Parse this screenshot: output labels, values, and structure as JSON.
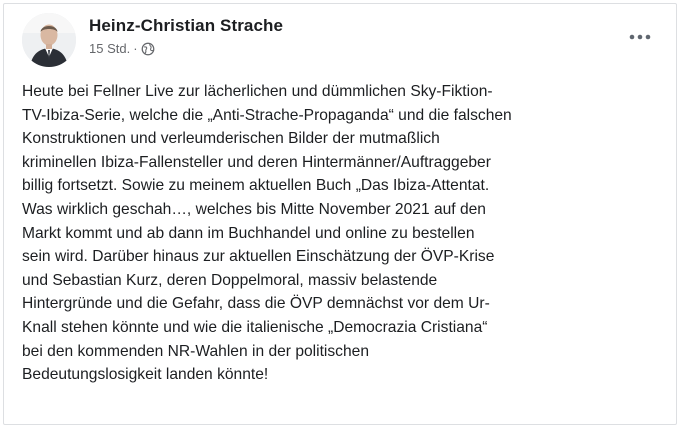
{
  "post": {
    "author": "Heinz-Christian Strache",
    "timestamp": "15 Std.",
    "separator": "·",
    "audience_icon": "globe-icon",
    "more_icon": "more-options-icon",
    "text": "Heute bei Fellner Live zur lächerlichen und dümmlichen Sky-Fiktion-\nTV-Ibiza-Serie, welche die „Anti-Strache-Propaganda“ und die falschen\nKonstruktionen und verleumderischen Bilder der mutmaßlich\nkriminellen Ibiza-Fallensteller und deren Hintermänner/Auftraggeber\nbillig fortsetzt. Sowie zu meinem aktuellen Buch „Das Ibiza-Attentat.\nWas wirklich geschah…, welches bis Mitte November 2021 auf den\nMarkt kommt und ab dann im Buchhandel und online zu bestellen\nsein wird. Darüber hinaus zur aktuellen Einschätzung der ÖVP-Krise\nund Sebastian Kurz, deren Doppelmoral, massiv belastende\nHintergründe und die Gefahr, dass die ÖVP demnächst vor dem Ur-\nKnall stehen könnte und wie die italienische  „Democrazia Cristiana“\nbei den kommenden NR-Wahlen in der politischen\nBedeutungslosigkeit landen könnte!"
  },
  "colors": {
    "text": "#1c1e21",
    "secondary": "#65676b",
    "border": "#dddfe2"
  }
}
